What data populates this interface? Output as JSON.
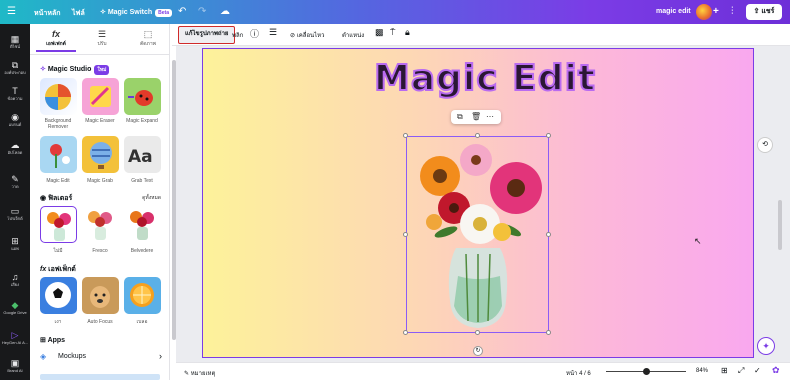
{
  "topbar": {
    "home": "หน้าหลัก",
    "file": "ไฟล์",
    "magic_switch": "Magic Switch",
    "magic_switch_badge": "Beta",
    "project_title": "magic edit",
    "share_label": "แชร์"
  },
  "rail": [
    {
      "icon": "▦",
      "label": "ดีไซน์"
    },
    {
      "icon": "⧉",
      "label": "องค์ประกอบ"
    },
    {
      "icon": "T",
      "label": "ข้อความ"
    },
    {
      "icon": "◉",
      "label": "แบรนด์"
    },
    {
      "icon": "☁",
      "label": "อัปโหลด"
    },
    {
      "icon": "✎",
      "label": "วาด"
    },
    {
      "icon": "▭",
      "label": "โปรเจ็กต์"
    },
    {
      "icon": "⊞",
      "label": "แอพ"
    },
    {
      "icon": "♫",
      "label": "เสียง"
    },
    {
      "icon": "◆",
      "label": "Google Drive"
    },
    {
      "icon": "▷",
      "label": "HeyGen AI A..."
    },
    {
      "icon": "▣",
      "label": "Brand AI"
    }
  ],
  "panel": {
    "tabs": [
      {
        "icon": "fx",
        "label": "เอฟเฟกต์"
      },
      {
        "icon": "☰",
        "label": "ปรับ"
      },
      {
        "icon": "⬚",
        "label": "ตัดภาพ"
      }
    ],
    "magic_studio_title": "Magic Studio",
    "magic_studio_badge": "ใหม่",
    "magic_tools": [
      {
        "label": "Background Remover"
      },
      {
        "label": "Magic Eraser"
      },
      {
        "label": "Magic Expand"
      },
      {
        "label": "Magic Edit"
      },
      {
        "label": "Magic Grab"
      },
      {
        "label": "Grab Text"
      }
    ],
    "filters_title": "ฟิลเตอร์",
    "filters_see_all": "ดูทั้งหมด",
    "filters": [
      {
        "label": "ไม่มี"
      },
      {
        "label": "Fresco"
      },
      {
        "label": "Belvedere"
      }
    ],
    "effects_title": "เอฟเฟ็กต์",
    "effects": [
      {
        "label": "เงา"
      },
      {
        "label": "Auto Focus"
      },
      {
        "label": "เบลอ"
      }
    ],
    "apps_title": "Apps",
    "mockups_label": "Mockups"
  },
  "context_toolbar": {
    "edit_photo": "แก้ไขรูปภาพถ่าย",
    "flip": "พลิก",
    "info_icon": "ⓘ",
    "animate": "เคลื่อนไหว",
    "position": "ตำแหน่ง"
  },
  "canvas": {
    "title_text": "Magic Edit"
  },
  "footer": {
    "notes": "หมายเหตุ",
    "page_indicator": "หน้า 4 / 6",
    "zoom": "84%",
    "zoom_fraction": 0.5
  }
}
